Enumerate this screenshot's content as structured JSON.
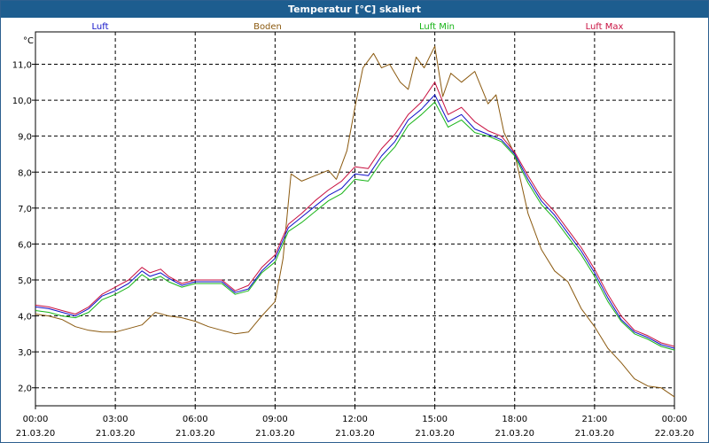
{
  "window": {
    "title": "Temperatur [°C] skaliert"
  },
  "chart_data": {
    "type": "line",
    "ylabel": "°C",
    "ylim": [
      1.5,
      11.9
    ],
    "xlim": [
      "21.03.20 00:00",
      "22.03.20 00:00"
    ],
    "grid": true,
    "legend_placement": "top",
    "y_ticks": [
      {
        "value": 2.0,
        "label": "2,0"
      },
      {
        "value": 3.0,
        "label": "3,0"
      },
      {
        "value": 4.0,
        "label": "4,0"
      },
      {
        "value": 5.0,
        "label": "5,0"
      },
      {
        "value": 6.0,
        "label": "6,0"
      },
      {
        "value": 7.0,
        "label": "7,0"
      },
      {
        "value": 8.0,
        "label": "8,0"
      },
      {
        "value": 9.0,
        "label": "9,0"
      },
      {
        "value": 10.0,
        "label": "10,0"
      },
      {
        "value": 11.0,
        "label": "11,0"
      }
    ],
    "x_ticks": [
      {
        "hour": 0,
        "time": "00:00",
        "date": "21.03.20"
      },
      {
        "hour": 3,
        "time": "03:00",
        "date": "21.03.20"
      },
      {
        "hour": 6,
        "time": "06:00",
        "date": "21.03.20"
      },
      {
        "hour": 9,
        "time": "09:00",
        "date": "21.03.20"
      },
      {
        "hour": 12,
        "time": "12:00",
        "date": "21.03.20"
      },
      {
        "hour": 15,
        "time": "15:00",
        "date": "21.03.20"
      },
      {
        "hour": 18,
        "time": "18:00",
        "date": "21.03.20"
      },
      {
        "hour": 21,
        "time": "21:00",
        "date": "21.03.20"
      },
      {
        "hour": 24,
        "time": "00:00",
        "date": "22.03.20"
      }
    ],
    "series": [
      {
        "name": "Luft",
        "color": "#1010c8",
        "x": [
          0,
          0.5,
          1,
          1.5,
          2,
          2.5,
          3,
          3.5,
          4,
          4.3,
          4.7,
          5,
          5.5,
          6,
          6.5,
          7,
          7.5,
          8,
          8.5,
          9,
          9.5,
          10,
          10.5,
          11,
          11.5,
          12,
          12.5,
          13,
          13.5,
          14,
          14.5,
          15,
          15.5,
          16,
          16.5,
          17,
          17.5,
          18,
          18.5,
          19,
          19.5,
          20,
          20.5,
          21,
          21.5,
          22,
          22.5,
          23,
          23.5,
          24
        ],
        "y": [
          4.25,
          4.2,
          4.1,
          4.0,
          4.2,
          4.55,
          4.7,
          4.9,
          5.25,
          5.1,
          5.2,
          5.05,
          4.85,
          4.95,
          4.95,
          4.95,
          4.65,
          4.75,
          5.25,
          5.6,
          6.45,
          6.75,
          7.05,
          7.35,
          7.55,
          7.95,
          7.9,
          8.45,
          8.85,
          9.45,
          9.75,
          10.15,
          9.4,
          9.6,
          9.2,
          9.05,
          8.9,
          8.5,
          7.8,
          7.2,
          6.8,
          6.3,
          5.8,
          5.2,
          4.5,
          3.9,
          3.55,
          3.4,
          3.2,
          3.1
        ]
      },
      {
        "name": "Boden",
        "color": "#8b5a10",
        "x": [
          0,
          0.5,
          1,
          1.5,
          2,
          2.5,
          3,
          3.5,
          4,
          4.5,
          5,
          5.5,
          6,
          6.5,
          7,
          7.5,
          8,
          8.5,
          9,
          9.3,
          9.6,
          10,
          10.5,
          11,
          11.3,
          11.7,
          12,
          12.3,
          12.7,
          13,
          13.3,
          13.7,
          14,
          14.3,
          14.6,
          15,
          15.3,
          15.6,
          16,
          16.5,
          17,
          17.3,
          17.6,
          18,
          18.5,
          19,
          19.5,
          20,
          20.5,
          21,
          21.5,
          22,
          22.5,
          23,
          23.5,
          24
        ],
        "y": [
          4.05,
          4.0,
          3.9,
          3.7,
          3.6,
          3.55,
          3.55,
          3.65,
          3.75,
          4.1,
          4.0,
          3.95,
          3.85,
          3.7,
          3.6,
          3.5,
          3.55,
          4.0,
          4.4,
          5.6,
          7.95,
          7.75,
          7.9,
          8.05,
          7.8,
          8.6,
          9.8,
          10.9,
          11.3,
          10.9,
          11.0,
          10.5,
          10.3,
          11.2,
          10.9,
          11.5,
          10.1,
          10.75,
          10.5,
          10.8,
          9.9,
          10.15,
          9.1,
          8.5,
          6.85,
          5.85,
          5.25,
          4.95,
          4.2,
          3.7,
          3.1,
          2.7,
          2.25,
          2.05,
          2.0,
          1.75
        ]
      },
      {
        "name": "Luft Min",
        "color": "#18b418",
        "x": [
          0,
          0.5,
          1,
          1.5,
          2,
          2.5,
          3,
          3.5,
          4,
          4.3,
          4.7,
          5,
          5.5,
          6,
          6.5,
          7,
          7.5,
          8,
          8.5,
          9,
          9.5,
          10,
          10.5,
          11,
          11.5,
          12,
          12.5,
          13,
          13.5,
          14,
          14.5,
          15,
          15.5,
          16,
          16.5,
          17,
          17.5,
          18,
          18.5,
          19,
          19.5,
          20,
          20.5,
          21,
          21.5,
          22,
          22.5,
          23,
          23.5,
          24
        ],
        "y": [
          4.15,
          4.1,
          4.0,
          3.95,
          4.1,
          4.45,
          4.6,
          4.8,
          5.15,
          5.0,
          5.1,
          4.95,
          4.8,
          4.9,
          4.9,
          4.9,
          4.6,
          4.7,
          5.2,
          5.5,
          6.35,
          6.6,
          6.9,
          7.2,
          7.4,
          7.8,
          7.75,
          8.3,
          8.7,
          9.3,
          9.6,
          9.95,
          9.25,
          9.45,
          9.1,
          9.0,
          8.85,
          8.45,
          7.7,
          7.1,
          6.7,
          6.2,
          5.7,
          5.1,
          4.4,
          3.85,
          3.5,
          3.35,
          3.15,
          3.05
        ]
      },
      {
        "name": "Luft Max",
        "color": "#c81040",
        "x": [
          0,
          0.5,
          1,
          1.5,
          2,
          2.5,
          3,
          3.5,
          4,
          4.3,
          4.7,
          5,
          5.5,
          6,
          6.5,
          7,
          7.5,
          8,
          8.5,
          9,
          9.5,
          10,
          10.5,
          11,
          11.5,
          12,
          12.5,
          13,
          13.5,
          14,
          14.5,
          15,
          15.5,
          16,
          16.5,
          17,
          17.5,
          18,
          18.5,
          19,
          19.5,
          20,
          20.5,
          21,
          21.5,
          22,
          22.5,
          23,
          23.5,
          24
        ],
        "y": [
          4.3,
          4.25,
          4.15,
          4.05,
          4.25,
          4.6,
          4.8,
          5.0,
          5.35,
          5.2,
          5.3,
          5.1,
          4.9,
          5.0,
          5.0,
          5.0,
          4.7,
          4.85,
          5.35,
          5.7,
          6.55,
          6.85,
          7.2,
          7.5,
          7.75,
          8.15,
          8.1,
          8.65,
          9.05,
          9.6,
          9.95,
          10.5,
          9.6,
          9.8,
          9.4,
          9.15,
          9.0,
          8.55,
          7.9,
          7.3,
          6.9,
          6.4,
          5.9,
          5.3,
          4.6,
          4.0,
          3.6,
          3.45,
          3.25,
          3.15
        ]
      }
    ]
  }
}
